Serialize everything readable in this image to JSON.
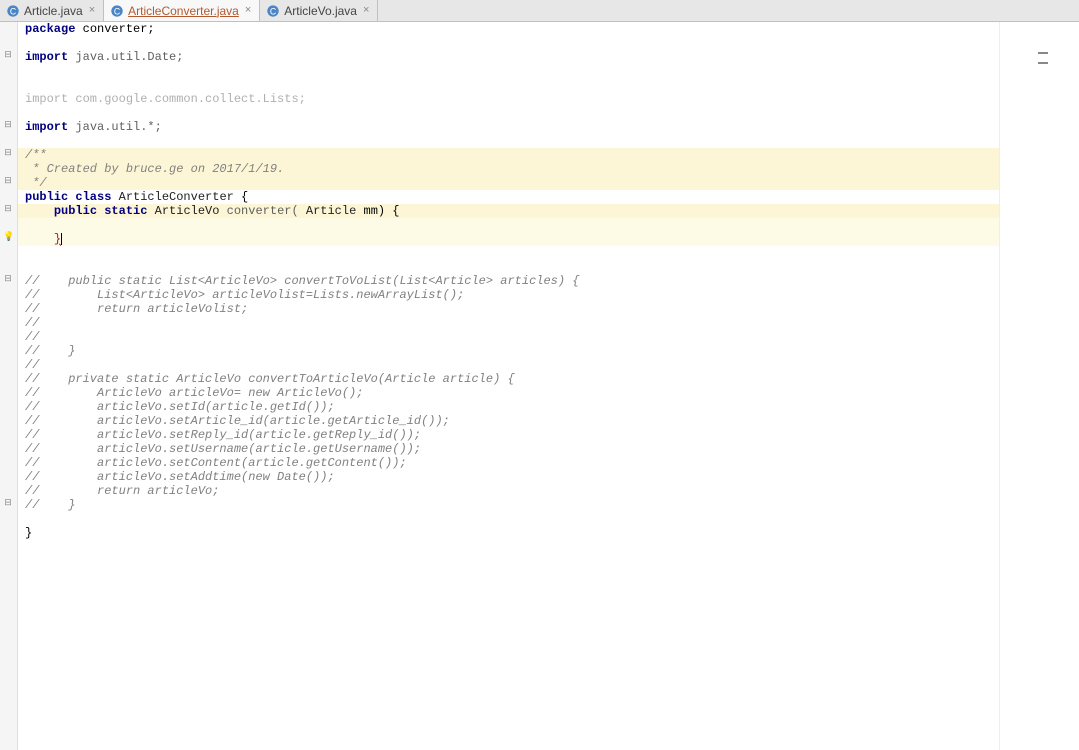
{
  "tabs": [
    {
      "label": "Article.java",
      "active": false
    },
    {
      "label": "ArticleConverter.java",
      "active": true
    },
    {
      "label": "ArticleVo.java",
      "active": false
    }
  ],
  "code": {
    "l1": {
      "kw": "package",
      "rest": " converter;"
    },
    "l2": "",
    "l3": {
      "kw": "import",
      "rest": " java.util.Date;"
    },
    "l4": "",
    "l5": "",
    "l6": {
      "faint": "import com.google.common.collect.Lists;"
    },
    "l7": "",
    "l8": {
      "kw": "import",
      "rest": " java.util.*;"
    },
    "l9": "",
    "l10": "/**",
    "l11": " * Created by bruce.ge on 2017/1/19.",
    "l12": " */",
    "l13": {
      "pre": "",
      "kw1": "public class ",
      "cls": "ArticleConverter",
      "post": " {"
    },
    "l14": {
      "pre": "    ",
      "kw1": "public static ",
      "cls": "ArticleVo",
      "mid": " converter( ",
      "cls2": "Article",
      "post": " mm) {"
    },
    "l15": "",
    "l16": "",
    "l17pre": "    ",
    "l18": "",
    "l19": "",
    "l20": "//    public static List<ArticleVo> convertToVoList(List<Article> articles) {",
    "l21": "//        List<ArticleVo> articleVolist=Lists.newArrayList();",
    "l22": "//        return articleVolist;",
    "l23": "//",
    "l24": "//",
    "l25": "//    }",
    "l26": "//",
    "l27": "//    private static ArticleVo convertToArticleVo(Article article) {",
    "l28": "//        ArticleVo articleVo= new ArticleVo();",
    "l29": "//        articleVo.setId(article.getId());",
    "l30": "//        articleVo.setArticle_id(article.getArticle_id());",
    "l31": "//        articleVo.setReply_id(article.getReply_id());",
    "l32": "//        articleVo.setUsername(article.getUsername());",
    "l33": "//        articleVo.setContent(article.getContent());",
    "l34": "//        articleVo.setAddtime(new Date());",
    "l35": "//        return articleVo;",
    "l36": "//    }",
    "l37": "",
    "l38": "}"
  }
}
